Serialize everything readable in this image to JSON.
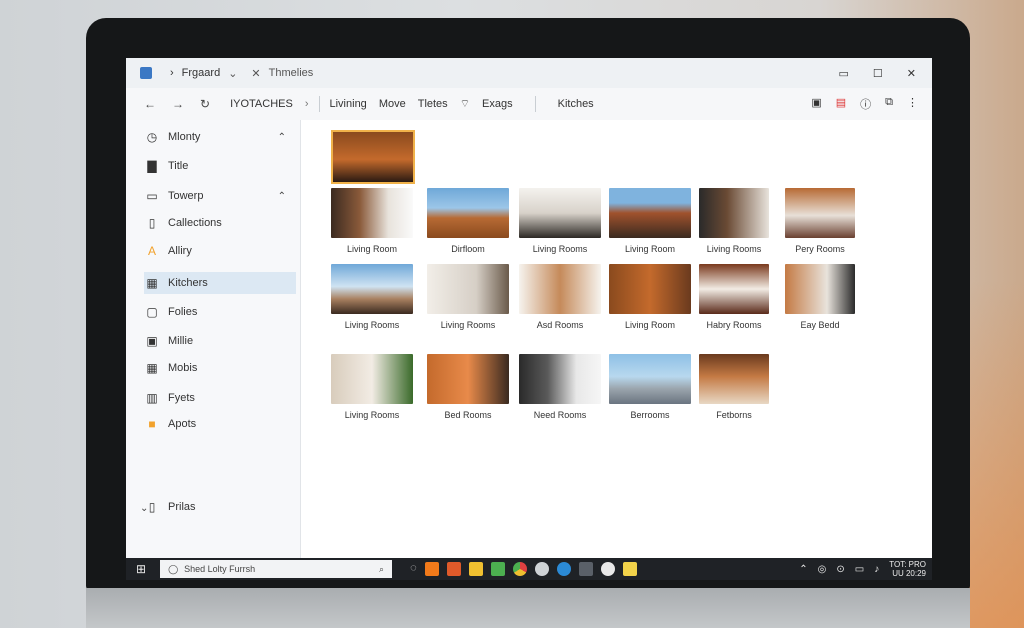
{
  "window": {
    "tab1_title": "Frgaard",
    "tab1_arrow": "⌄",
    "tab2_close": "✕",
    "tab2_title": "Thmelies",
    "controls": [
      "▭",
      "☐",
      "✕"
    ]
  },
  "addressbar": {
    "back": "←",
    "forward": "→",
    "refresh": "↻",
    "root": "IYOTACHES",
    "sep": "›",
    "crumbs": [
      "Livining",
      "Move",
      "Tletes",
      "Exags",
      "Kitches"
    ],
    "right_icons": [
      "▣",
      "▤",
      "ⓘ",
      "⧉",
      "⋮"
    ]
  },
  "sidebar": {
    "items": [
      {
        "icon": "clock-icon",
        "glyph": "◷",
        "label": "Mlonty",
        "chevron": "⌃"
      },
      {
        "icon": "image-icon",
        "glyph": "▇",
        "label": "Title"
      },
      {
        "icon": "folder-icon",
        "glyph": "▭",
        "label": "Towerp",
        "chevron": "⌃"
      },
      {
        "icon": "document-icon",
        "glyph": "▯",
        "label": "Callections"
      },
      {
        "icon": "alert-icon",
        "glyph": "A",
        "label": "Alliry"
      },
      {
        "icon": "kitchen-icon",
        "glyph": "▦",
        "label": "Kitchers"
      },
      {
        "icon": "file-icon",
        "glyph": "▢",
        "label": "Folies"
      },
      {
        "icon": "music-icon",
        "glyph": "▣",
        "label": "Millie"
      },
      {
        "icon": "grid-icon",
        "glyph": "▦",
        "label": "Mobis"
      },
      {
        "icon": "book-icon",
        "glyph": "▥",
        "label": "Fyets"
      },
      {
        "icon": "folder-orange-icon",
        "glyph": "■",
        "label": "Apots"
      },
      {
        "icon": "print-icon",
        "glyph": "▯",
        "label": "Prilas",
        "collapse": "⌄"
      }
    ]
  },
  "gallery": {
    "row1": [
      "Living Room",
      "Dirfloom",
      "Living Rooms",
      "Living Room",
      "Living Rooms",
      "Pery Rooms"
    ],
    "row2": [
      "Living Rooms",
      "Living Rooms",
      "Asd Rooms",
      "Living Room",
      "Habry Rooms",
      "Eay Bedd"
    ],
    "row3": [
      "Living Rooms",
      "Bed Rooms",
      "Need Rooms",
      "Berrooms",
      "Fetborns"
    ],
    "colors": {
      "warm": "#b76a34",
      "white": "#e8e3dc",
      "sky": "#6fa8d8",
      "dark": "#3a2a20"
    }
  },
  "taskbar": {
    "start": "⊞",
    "search_icon": "◯",
    "search_placeholder": "Shed Lolty Furrsh",
    "mic": "⌕",
    "apps": [
      "#f27a1a",
      "#e05a2a",
      "#f0c030",
      "#f2d24a",
      "#4caf50",
      "#e04040",
      "#2b8ad6",
      "#3a8fd2",
      "#9aa0a6",
      "#cfd3d6"
    ],
    "tray": [
      "⌃",
      "◎",
      "⊙",
      "▭",
      "♪"
    ],
    "clock_line1": "TOT: PRO",
    "clock_line2": "UU 20:29"
  }
}
